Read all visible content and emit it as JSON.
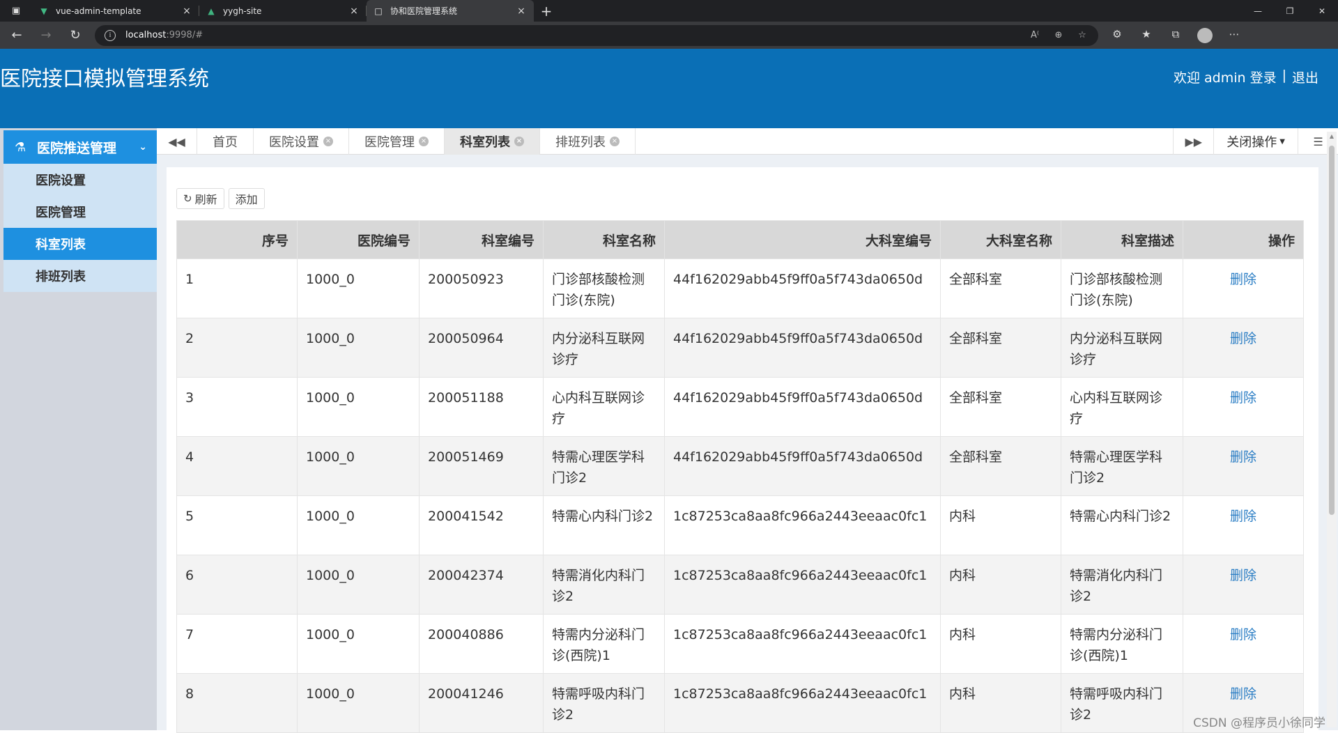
{
  "browser": {
    "tabs": [
      {
        "title": "vue-admin-template",
        "icon": "vue-icon",
        "active": false
      },
      {
        "title": "yygh-site",
        "icon": "nuxt-icon",
        "active": false
      },
      {
        "title": "协和医院管理系统",
        "icon": "page-icon",
        "active": true
      }
    ],
    "url_host": "localhost",
    "url_rest": ":9998/#"
  },
  "header": {
    "title": "医院接口模拟管理系统",
    "welcome": "欢迎 admin 登录",
    "separator": "|",
    "logout": "退出"
  },
  "sidebar": {
    "group_label": "医院推送管理",
    "items": [
      {
        "label": "医院设置",
        "active": false
      },
      {
        "label": "医院管理",
        "active": false
      },
      {
        "label": "科室列表",
        "active": true
      },
      {
        "label": "排班列表",
        "active": false
      }
    ]
  },
  "page_tabs": {
    "items": [
      {
        "label": "首页",
        "closable": false,
        "active": false
      },
      {
        "label": "医院设置",
        "closable": true,
        "active": false
      },
      {
        "label": "医院管理",
        "closable": true,
        "active": false
      },
      {
        "label": "科室列表",
        "closable": true,
        "active": true
      },
      {
        "label": "排班列表",
        "closable": true,
        "active": false
      }
    ],
    "close_ops": "关闭操作"
  },
  "toolbar": {
    "refresh": "刷新",
    "add": "添加"
  },
  "table": {
    "columns": [
      "序号",
      "医院编号",
      "科室编号",
      "科室名称",
      "大科室编号",
      "大科室名称",
      "科室描述",
      "操作"
    ],
    "rows": [
      {
        "no": "1",
        "hoscode": "1000_0",
        "depcode": "200050923",
        "depname": "门诊部核酸检测门诊(东院)",
        "bigcode": "44f162029abb45f9ff0a5f743da0650d",
        "bigname": "全部科室",
        "intro": "门诊部核酸检测门诊(东院)",
        "op": "删除"
      },
      {
        "no": "2",
        "hoscode": "1000_0",
        "depcode": "200050964",
        "depname": "内分泌科互联网诊疗",
        "bigcode": "44f162029abb45f9ff0a5f743da0650d",
        "bigname": "全部科室",
        "intro": "内分泌科互联网诊疗",
        "op": "删除"
      },
      {
        "no": "3",
        "hoscode": "1000_0",
        "depcode": "200051188",
        "depname": "心内科互联网诊疗",
        "bigcode": "44f162029abb45f9ff0a5f743da0650d",
        "bigname": "全部科室",
        "intro": "心内科互联网诊疗",
        "op": "删除"
      },
      {
        "no": "4",
        "hoscode": "1000_0",
        "depcode": "200051469",
        "depname": "特需心理医学科门诊2",
        "bigcode": "44f162029abb45f9ff0a5f743da0650d",
        "bigname": "全部科室",
        "intro": "特需心理医学科门诊2",
        "op": "删除"
      },
      {
        "no": "5",
        "hoscode": "1000_0",
        "depcode": "200041542",
        "depname": "特需心内科门诊2",
        "bigcode": "1c87253ca8aa8fc966a2443eeaac0fc1",
        "bigname": "内科",
        "intro": "特需心内科门诊2",
        "op": "删除"
      },
      {
        "no": "6",
        "hoscode": "1000_0",
        "depcode": "200042374",
        "depname": "特需消化内科门诊2",
        "bigcode": "1c87253ca8aa8fc966a2443eeaac0fc1",
        "bigname": "内科",
        "intro": "特需消化内科门诊2",
        "op": "删除"
      },
      {
        "no": "7",
        "hoscode": "1000_0",
        "depcode": "200040886",
        "depname": "特需内分泌科门诊(西院)1",
        "bigcode": "1c87253ca8aa8fc966a2443eeaac0fc1",
        "bigname": "内科",
        "intro": "特需内分泌科门诊(西院)1",
        "op": "删除"
      },
      {
        "no": "8",
        "hoscode": "1000_0",
        "depcode": "200041246",
        "depname": "特需呼吸内科门诊2",
        "bigcode": "1c87253ca8aa8fc966a2443eeaac0fc1",
        "bigname": "内科",
        "intro": "特需呼吸内科门诊2",
        "op": "删除"
      }
    ]
  },
  "watermark": "CSDN @程序员小徐同学",
  "colors": {
    "header_bg": "#0a6fb6",
    "sidebar_active": "#1e90e0",
    "link": "#2a7dc4"
  }
}
